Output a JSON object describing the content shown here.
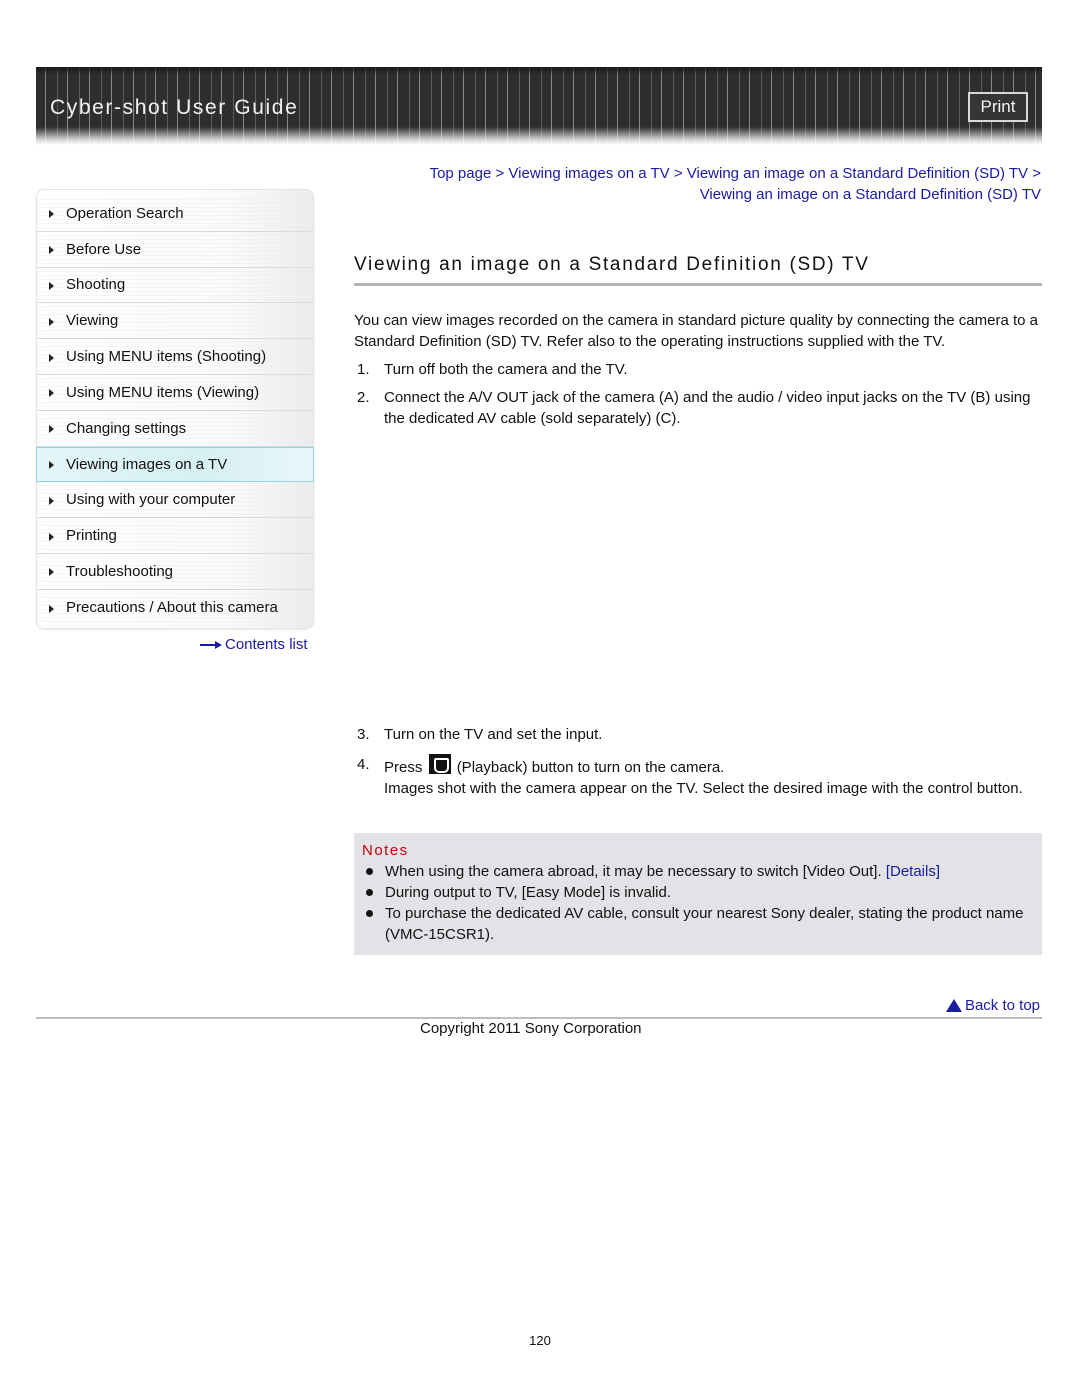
{
  "header": {
    "title": "Cyber-shot User Guide",
    "print_label": "Print"
  },
  "sidebar": {
    "items": [
      {
        "label": "Operation Search",
        "active": false
      },
      {
        "label": "Before Use",
        "active": false
      },
      {
        "label": "Shooting",
        "active": false
      },
      {
        "label": "Viewing",
        "active": false
      },
      {
        "label": "Using MENU items (Shooting)",
        "active": false
      },
      {
        "label": "Using MENU items (Viewing)",
        "active": false
      },
      {
        "label": "Changing settings",
        "active": false
      },
      {
        "label": "Viewing images on a TV",
        "active": true
      },
      {
        "label": "Using with your computer",
        "active": false
      },
      {
        "label": "Printing",
        "active": false
      },
      {
        "label": "Troubleshooting",
        "active": false
      },
      {
        "label": "Precautions / About this camera",
        "active": false
      }
    ],
    "contents_link": "Contents list"
  },
  "breadcrumb": {
    "items": [
      "Top page",
      "Viewing images on a TV",
      "Viewing an image on a Standard Definition (SD) TV",
      "Viewing an image on a Standard Definition (SD) TV"
    ],
    "separator": ">"
  },
  "main": {
    "title": "Viewing an image on a Standard Definition (SD) TV",
    "intro": "You can view images recorded on the camera in standard picture quality by connecting the camera to a Standard Definition (SD) TV. Refer also to the operating instructions supplied with the TV.",
    "steps": [
      {
        "num": "1.",
        "text": "Turn off both the camera and the TV."
      },
      {
        "num": "2.",
        "text": "Connect the A/V OUT jack of the camera (A) and the audio / video input jacks on the TV (B) using the dedicated AV cable (sold separately) (C)."
      },
      {
        "num": "3.",
        "text": "Turn on the TV and set the input."
      },
      {
        "num": "4.",
        "text_before": "Press",
        "icon": "playback-icon",
        "text_after": "(Playback) button to turn on the camera.",
        "detail": "Images shot with the camera appear on the TV. Select the desired image with the control button."
      }
    ]
  },
  "notes": {
    "title": "Notes",
    "items": [
      {
        "text": "When using the camera abroad, it may be necessary to switch [Video Out].",
        "link": "[Details]"
      },
      {
        "text": "During output to TV, [Easy Mode] is invalid."
      },
      {
        "text": "To purchase the dedicated AV cable, consult your nearest Sony dealer, stating the product name (VMC-15CSR1)."
      }
    ]
  },
  "footer": {
    "back_to_top": "Back to top",
    "copyright": "Copyright 2011 Sony Corporation",
    "page_number": "120"
  },
  "colors": {
    "link": "#1a1aa6",
    "notes_title": "#c8000a",
    "notes_bg": "#e3e3e7",
    "active_nav_bg": "#d6f0f3",
    "banner_bg": "#2e2e2e"
  }
}
